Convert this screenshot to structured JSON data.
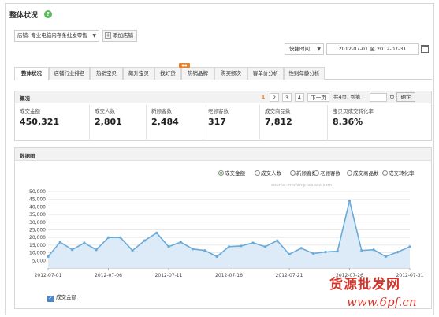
{
  "page": {
    "title": "整体状况"
  },
  "filters": {
    "shop_select": "店铺: 专业电脑内存条批发零售",
    "add_shop": "添加店铺",
    "quick_time": "快捷时间",
    "date_range": "2012-07-01 至 2012-07-31"
  },
  "tabs": [
    {
      "label": "整体状况",
      "active": true
    },
    {
      "label": "店铺行业排名"
    },
    {
      "label": "热销宝贝"
    },
    {
      "label": "飙升宝贝"
    },
    {
      "label": "找好货"
    },
    {
      "label": "热销品牌"
    },
    {
      "label": "购买频次"
    },
    {
      "label": "客单价分析"
    },
    {
      "label": "性别年龄分析"
    }
  ],
  "overview": {
    "title": "概况",
    "pagination": {
      "pages": [
        "1",
        "2",
        "3",
        "4"
      ],
      "current": "1",
      "next": "下一页",
      "total_text": "共4页, 到第",
      "page_suffix": "页",
      "confirm": "确定"
    },
    "metrics": [
      {
        "label": "成交金额",
        "value": "450,321"
      },
      {
        "label": "成交人数",
        "value": "2,801"
      },
      {
        "label": "新顾客数",
        "value": "2,484"
      },
      {
        "label": "老顾客数",
        "value": "317"
      },
      {
        "label": "成交商品数",
        "value": "7,812"
      },
      {
        "label": "宝贝页成交转化率",
        "value": "8.36%"
      }
    ]
  },
  "chart": {
    "title": "数据图",
    "metric_options": [
      {
        "label": "成交金额",
        "selected": true
      },
      {
        "label": "成交人数"
      },
      {
        "label": "新顾客数"
      },
      {
        "label": "老顾客数"
      },
      {
        "label": "成交商品数"
      },
      {
        "label": "成交转化率"
      }
    ],
    "source_watermark": "source: mofang.taobao.com"
  },
  "chart_data": {
    "type": "area",
    "x": [
      "2012-07-01",
      "2012-07-02",
      "2012-07-03",
      "2012-07-04",
      "2012-07-05",
      "2012-07-06",
      "2012-07-07",
      "2012-07-08",
      "2012-07-09",
      "2012-07-10",
      "2012-07-11",
      "2012-07-12",
      "2012-07-13",
      "2012-07-14",
      "2012-07-15",
      "2012-07-16",
      "2012-07-17",
      "2012-07-18",
      "2012-07-19",
      "2012-07-20",
      "2012-07-21",
      "2012-07-22",
      "2012-07-23",
      "2012-07-24",
      "2012-07-25",
      "2012-07-26",
      "2012-07-27",
      "2012-07-28",
      "2012-07-29",
      "2012-07-30",
      "2012-07-31"
    ],
    "x_tick_labels": [
      "2012-07-01",
      "2012-07-06",
      "2012-07-11",
      "2012-07-16",
      "2012-07-21",
      "2012-07-26",
      "2012-07-31"
    ],
    "series": [
      {
        "name": "成交金额",
        "color": "#6aaad8",
        "values": [
          7500,
          17000,
          12000,
          16500,
          12000,
          20000,
          20000,
          11500,
          18000,
          23000,
          14000,
          17000,
          12500,
          11500,
          7500,
          14000,
          14500,
          16500,
          14000,
          18000,
          9000,
          13000,
          9500,
          10500,
          11000,
          44000,
          11500,
          12000,
          7500,
          10500,
          14000
        ]
      }
    ],
    "ylim": [
      0,
      50000
    ],
    "y_ticks": [
      0,
      5000,
      10000,
      15000,
      20000,
      25000,
      30000,
      35000,
      40000,
      45000,
      50000
    ],
    "y_tick_labels": [
      "",
      "5,000",
      "10,000",
      "15,000",
      "20,000",
      "25,000",
      "30,000",
      "35,000",
      "40,000",
      "45,000",
      "50,000"
    ],
    "legend": {
      "label": "成交金额",
      "placement": "bottom-left"
    },
    "grid": true,
    "xlabel": "",
    "ylabel": ""
  },
  "watermark": {
    "text": "货源批发网",
    "url": "www.6pf.cn"
  }
}
